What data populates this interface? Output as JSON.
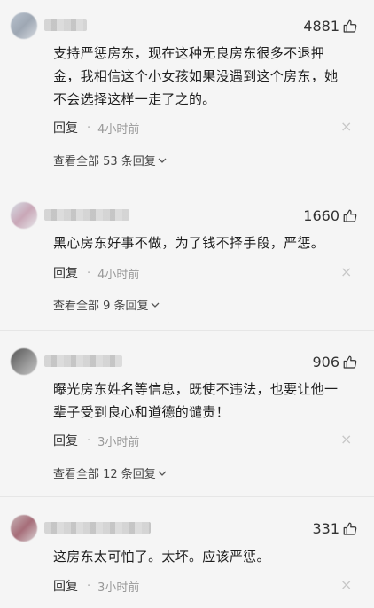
{
  "comments": [
    {
      "likes": "4881",
      "text_lines": [
        "支持严惩房东，现在这种无良房东很多不退押",
        "金，我相信这个小女孩如果没遇到这个房东，她",
        "不会选择这样一走了之的。"
      ],
      "reply_label": "回复",
      "time": "4小时前",
      "view_all": "查看全部 53 条回复"
    },
    {
      "likes": "1660",
      "text_lines": [
        "黑心房东好事不做，为了钱不择手段，严惩。"
      ],
      "reply_label": "回复",
      "time": "4小时前",
      "view_all": "查看全部 9 条回复"
    },
    {
      "likes": "906",
      "text_lines": [
        "曝光房东姓名等信息，既使不违法，也要让他一",
        "辈子受到良心和道德的谴责！"
      ],
      "reply_label": "回复",
      "time": "3小时前",
      "view_all": "查看全部 12 条回复"
    },
    {
      "likes": "331",
      "text_lines": [
        "这房东太可怕了。太坏。应该严惩。"
      ],
      "reply_label": "回复",
      "time": "3小时前"
    }
  ]
}
